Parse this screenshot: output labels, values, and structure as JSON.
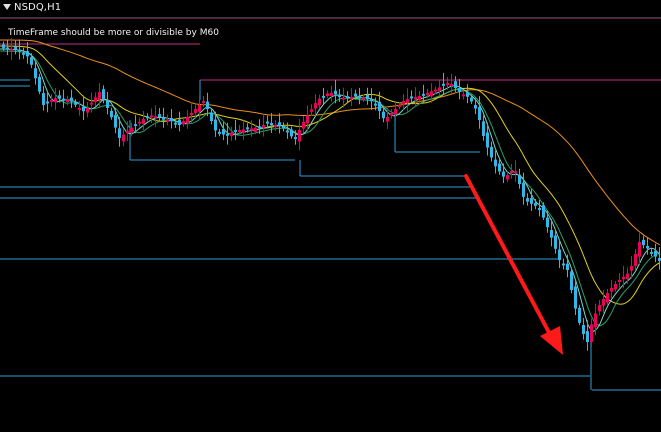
{
  "window": {
    "title": "NSDQ,H1",
    "notice": "TimeFrame should be more or divisible by M60"
  },
  "colors": {
    "background": "#000000",
    "bull_candle": "#e8005a",
    "bear_candle": "#2fb8e8",
    "ma_fast": "#7fd6c8",
    "ma_medium": "#e0d020",
    "ma_slow": "#e89020",
    "ma_signal": "#2aa06a",
    "level_magenta": "#c0308a",
    "level_blue": "#2f9fd8",
    "arrow": "#ff1a1a"
  },
  "icons": {
    "title_arrow": "triangle-down-icon",
    "annotation": "red-arrow-down-right"
  }
}
